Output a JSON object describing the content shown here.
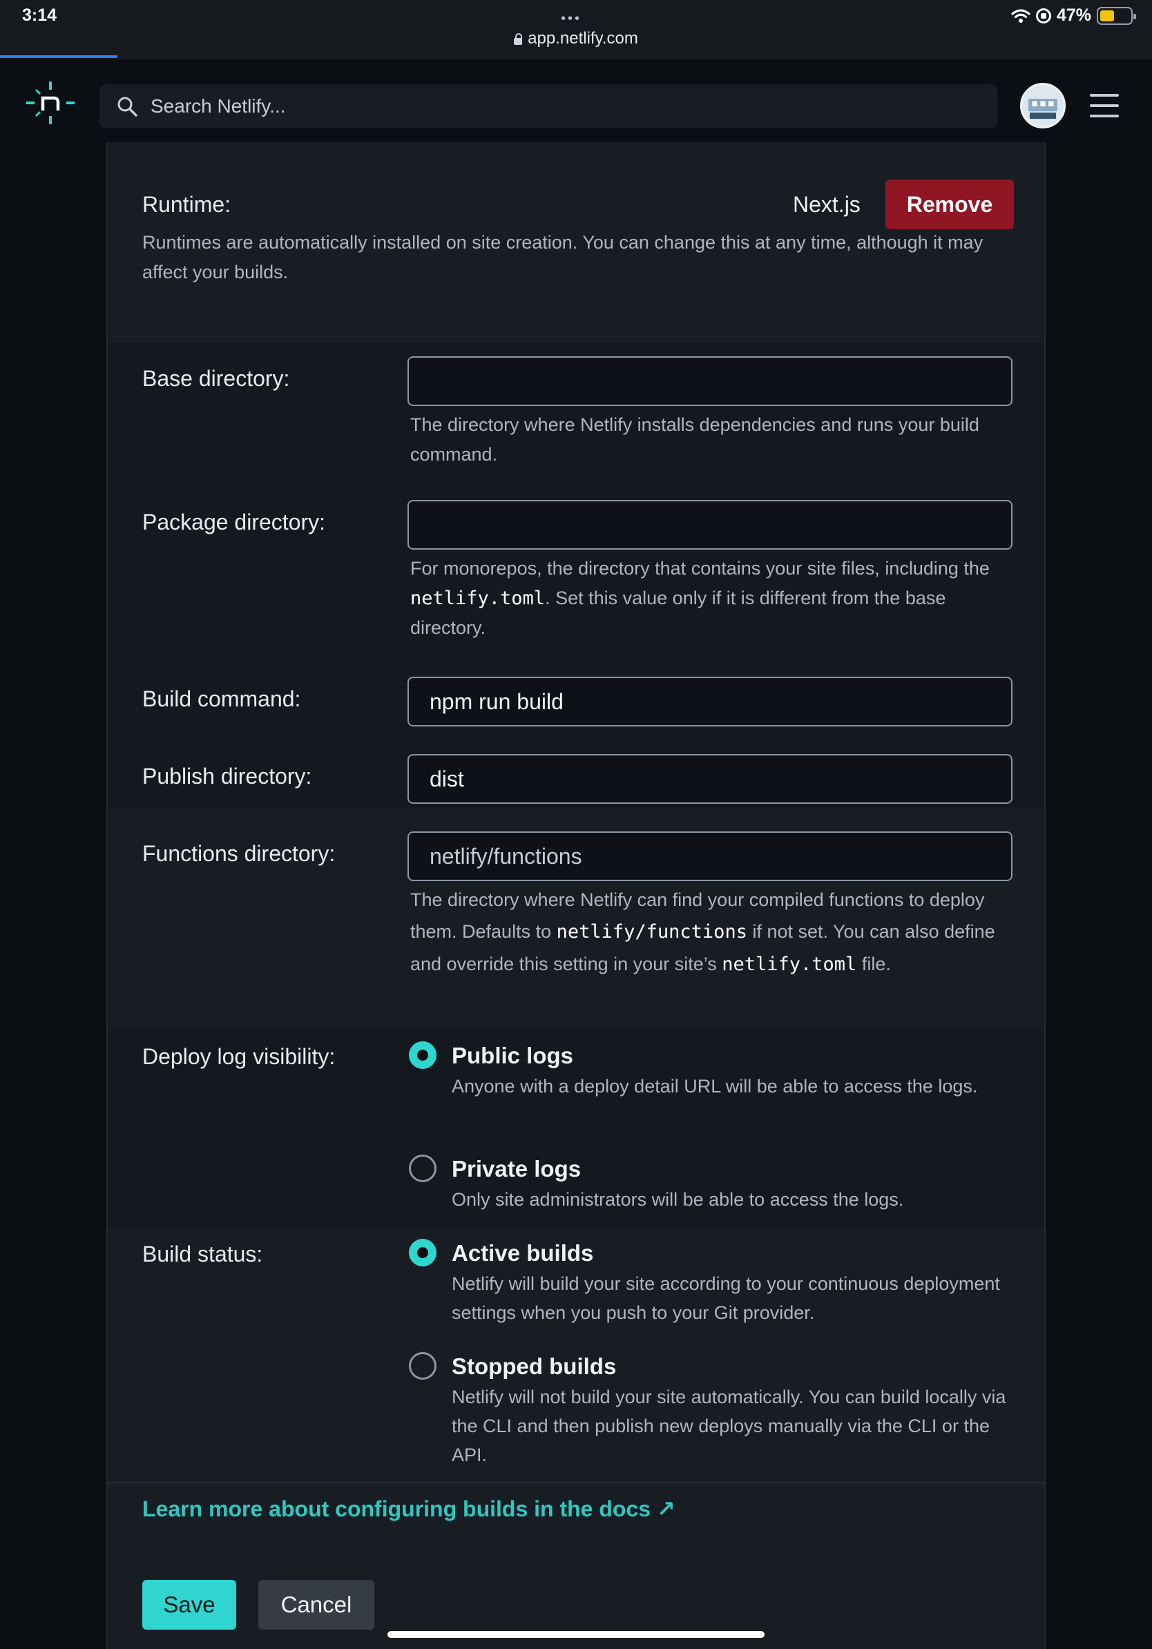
{
  "status_bar": {
    "time": "3:14",
    "dots": "•••",
    "battery": "47%",
    "battery_level": 0.47
  },
  "browser": {
    "url": "app.netlify.com"
  },
  "header": {
    "search_placeholder": "Search Netlify..."
  },
  "runtime": {
    "label": "Runtime:",
    "value": "Next.js",
    "remove_label": "Remove",
    "help": "Runtimes are automatically installed on site creation. You can change this at any time, although it may affect your builds."
  },
  "base_directory": {
    "label": "Base directory:",
    "value": "",
    "help": "The directory where Netlify installs dependencies and runs your build command."
  },
  "package_directory": {
    "label": "Package directory:",
    "value": "",
    "help_part1": "For monorepos, the directory that contains your site files, including the ",
    "help_code": "netlify.toml",
    "help_part2": ". Set this value only if it is different from the base directory."
  },
  "build_command": {
    "label": "Build command:",
    "value": "npm run build"
  },
  "publish_directory": {
    "label": "Publish directory:",
    "value": "dist"
  },
  "functions_directory": {
    "label": "Functions directory:",
    "placeholder": "netlify/functions",
    "help_part1": "The directory where Netlify can find your compiled functions to deploy them. Defaults to ",
    "help_code1": "netlify/functions",
    "help_part2": " if not set. You can also define and override this setting in your site’s ",
    "help_code2": "netlify.toml",
    "help_part3": " file."
  },
  "deploy_log_visibility": {
    "label": "Deploy log visibility:",
    "options": [
      {
        "title": "Public logs",
        "desc": "Anyone with a deploy detail URL will be able to access the logs.",
        "selected": true
      },
      {
        "title": "Private logs",
        "desc": "Only site administrators will be able to access the logs.",
        "selected": false
      }
    ]
  },
  "build_status": {
    "label": "Build status:",
    "options": [
      {
        "title": "Active builds",
        "desc": "Netlify will build your site according to your continuous deployment settings when you push to your Git provider.",
        "selected": true
      },
      {
        "title": "Stopped builds",
        "desc": "Netlify will not build your site automatically. You can build locally via the CLI and then publish new deploys manually via the CLI or the API.",
        "selected": false
      }
    ]
  },
  "docs_link": "Learn more about configuring builds in the docs ↗",
  "actions": {
    "save": "Save",
    "cancel": "Cancel"
  },
  "colors": {
    "accent": "#30d5cf",
    "danger": "#8f1622",
    "panel": "#181d24",
    "background": "#0b0f14"
  }
}
